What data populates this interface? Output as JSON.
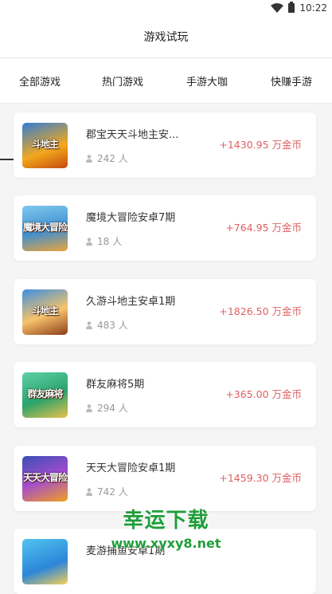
{
  "status": {
    "time": "10:22"
  },
  "header": {
    "title": "游戏试玩"
  },
  "tabs": [
    {
      "label": "全部游戏",
      "selected": true
    },
    {
      "label": "热门游戏",
      "selected": false
    },
    {
      "label": "手游大咖",
      "selected": false
    },
    {
      "label": "快赚手游",
      "selected": false
    }
  ],
  "games": [
    {
      "name": "郡宝天天斗地主安...",
      "players": "242 人",
      "reward": "+1430.95 万金币",
      "thumb_label": "斗地主",
      "icon": "doudizhu-game-icon"
    },
    {
      "name": "魔境大冒险安卓7期",
      "players": "18 人",
      "reward": "+764.95 万金币",
      "thumb_label": "魔境大冒险",
      "icon": "mojing-game-icon"
    },
    {
      "name": "久游斗地主安卓1期",
      "players": "483 人",
      "reward": "+1826.50 万金币",
      "thumb_label": "斗地主",
      "icon": "jiuyou-game-icon"
    },
    {
      "name": "群友麻将5期",
      "players": "294 人",
      "reward": "+365.00 万金币",
      "thumb_label": "群友麻将",
      "icon": "mahjong-game-icon"
    },
    {
      "name": "天天大冒险安卓1期",
      "players": "742 人",
      "reward": "+1459.30 万金币",
      "thumb_label": "天天大冒险",
      "icon": "maoxian-game-icon"
    },
    {
      "name": "麦游捕鱼安卓1期",
      "players": "",
      "reward": "",
      "thumb_label": "",
      "icon": "fishing-game-icon"
    }
  ],
  "watermark": {
    "title": "幸运下载",
    "url": "www.xyxy8.net"
  },
  "colors": {
    "reward": "#e06060",
    "watermark": "#1f9e3a"
  }
}
